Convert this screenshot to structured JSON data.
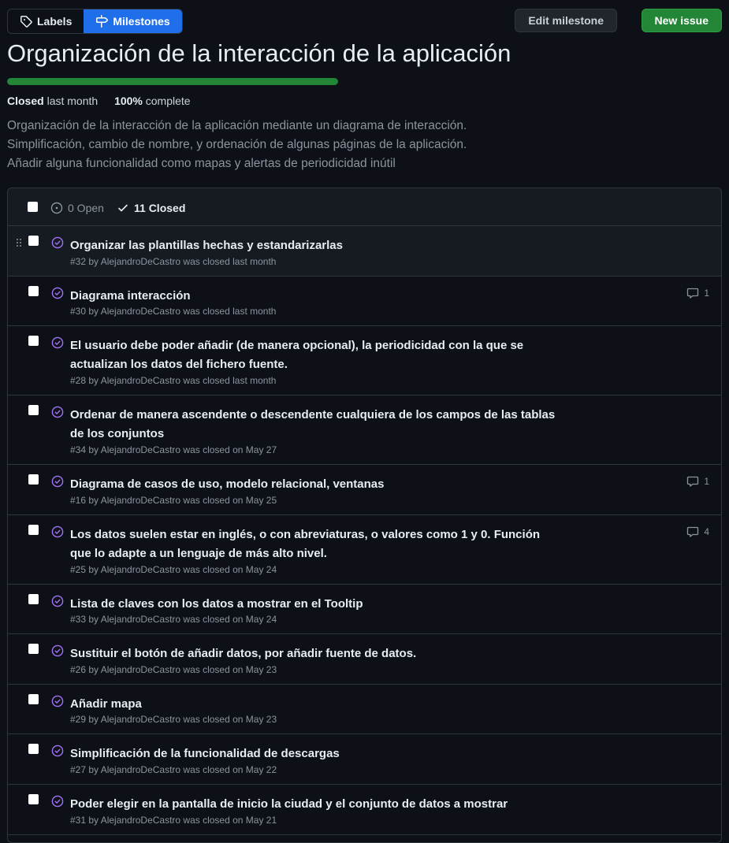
{
  "toolbar": {
    "labels_label": "Labels",
    "milestones_label": "Milestones",
    "edit_label": "Edit milestone",
    "new_issue_label": "New issue"
  },
  "milestone": {
    "title": "Organización de la interacción de la aplicación",
    "progress_fraction": 1.0,
    "closed_label": "Closed",
    "closed_when": "last month",
    "percent": "100%",
    "complete_label": "complete",
    "description": [
      "Organización de la interacción de la aplicación mediante un diagrama de interacción.",
      "Simplificación, cambio de nombre, y ordenación de algunas páginas de la aplicación.",
      "Añadir alguna funcionalidad como mapas y alertas de periodicidad inútil"
    ]
  },
  "list": {
    "open_label": "0 Open",
    "closed_label": "11 Closed",
    "issues": [
      {
        "title": "Organizar las plantillas hechas y estandarizarlas",
        "meta": "#32 by AlejandroDeCastro was closed last month",
        "comments": ""
      },
      {
        "title": "Diagrama interacción",
        "meta": "#30 by AlejandroDeCastro was closed last month",
        "comments": "1"
      },
      {
        "title": "El usuario debe poder añadir (de manera opcional), la periodicidad con la que se actualizan los datos del fichero fuente.",
        "meta": "#28 by AlejandroDeCastro was closed last month",
        "comments": ""
      },
      {
        "title": "Ordenar de manera ascendente o descendente cualquiera de los campos de las tablas de los conjuntos",
        "meta": "#34 by AlejandroDeCastro was closed on May 27",
        "comments": ""
      },
      {
        "title": "Diagrama de casos de uso, modelo relacional, ventanas",
        "meta": "#16 by AlejandroDeCastro was closed on May 25",
        "comments": "1"
      },
      {
        "title": "Los datos suelen estar en inglés, o con abreviaturas, o valores como 1 y 0. Función que lo adapte a un lenguaje de más alto nivel.",
        "meta": "#25 by AlejandroDeCastro was closed on May 24",
        "comments": "4"
      },
      {
        "title": "Lista de claves con los datos a mostrar en el Tooltip",
        "meta": "#33 by AlejandroDeCastro was closed on May 24",
        "comments": ""
      },
      {
        "title": "Sustituir el botón de añadir datos, por añadir fuente de datos.",
        "meta": "#26 by AlejandroDeCastro was closed on May 23",
        "comments": ""
      },
      {
        "title": "Añadir mapa",
        "meta": "#29 by AlejandroDeCastro was closed on May 23",
        "comments": ""
      },
      {
        "title": "Simplificación de la funcionalidad de descargas",
        "meta": "#27 by AlejandroDeCastro was closed on May 22",
        "comments": ""
      },
      {
        "title": "Poder elegir en la pantalla de inicio la ciudad y el conjunto de datos a mostrar",
        "meta": "#31 by AlejandroDeCastro was closed on May 21",
        "comments": ""
      }
    ]
  }
}
